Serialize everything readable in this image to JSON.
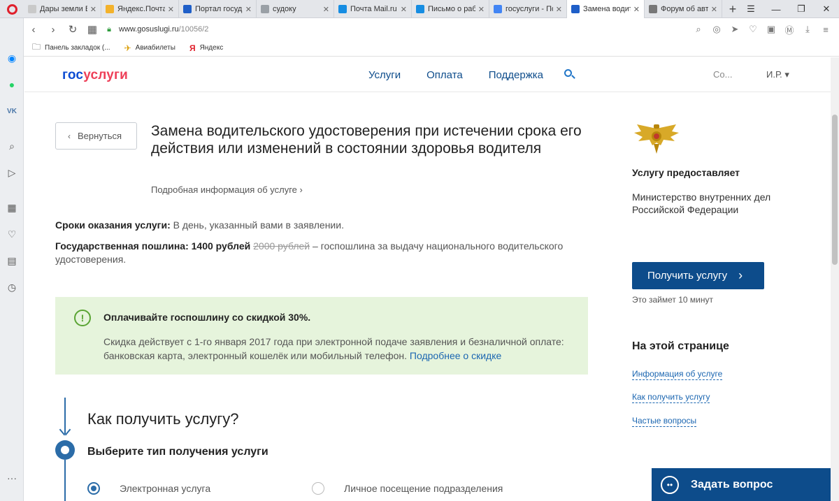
{
  "browser": {
    "tabs": [
      {
        "title": "Дары земли В",
        "fav_color": "#c9c9c9",
        "active": false
      },
      {
        "title": "Яндекс.Почта",
        "fav_color": "#f3b22b",
        "active": false
      },
      {
        "title": "Портал госуд",
        "fav_color": "#1f5fc8",
        "active": false
      },
      {
        "title": "судоку",
        "fav_color": "#9aa0a6",
        "active": false
      },
      {
        "title": "Почта Mail.ru",
        "fav_color": "#168de2",
        "active": false
      },
      {
        "title": "Письмо о раб",
        "fav_color": "#168de2",
        "active": false
      },
      {
        "title": "госуслуги - По",
        "fav_color": "#4285f4",
        "active": false
      },
      {
        "title": "Замена водит",
        "fav_color": "#1f5fc8",
        "active": true
      },
      {
        "title": "Форум об авт",
        "fav_color": "#777777",
        "active": false
      }
    ],
    "url_host": "www.gosuslugi.ru",
    "url_path": "/10056/2",
    "bookmarks": [
      {
        "label": "Панель закладок (...",
        "icon": "folder-icon"
      },
      {
        "label": "Авиабилеты",
        "icon": "plane-icon"
      },
      {
        "label": "Яндекс",
        "icon": "yandex-icon"
      }
    ]
  },
  "header": {
    "logo_part1": "гос",
    "logo_part2": "услуги",
    "nav": [
      "Услуги",
      "Оплата",
      "Поддержка"
    ],
    "user_org": "Со...",
    "user_name": "И.Р. ▾"
  },
  "service": {
    "back_label": "Вернуться",
    "title": "Замена водительского удостоверения при истечении срока его действия или изменений в состоянии здоровья водителя",
    "more_info": "Подробная информация об услуге",
    "terms_label": "Сроки оказания услуги:",
    "terms_value": "В день, указанный вами в заявлении.",
    "fee_label": "Государственная пошлина:",
    "fee_price": "1400 рублей",
    "fee_old": "2000 рублей",
    "fee_desc": "– госпошлина за выдачу национального водительского удостоверения."
  },
  "promo": {
    "title": "Оплачивайте госпошлину со скидкой 30%.",
    "text": "Скидка действует с 1-го января 2017 года при электронной подаче заявления и безналичной оплате: банковская карта, электронный кошелёк или мобильный телефон.",
    "link": "Подробнее о скидке"
  },
  "how": {
    "title": "Как получить услугу?",
    "step_title": "Выберите тип получения услуги",
    "options": [
      {
        "label": "Электронная услуга",
        "selected": true
      },
      {
        "label": "Личное посещение подразделения",
        "selected": false
      }
    ]
  },
  "side": {
    "provider_heading": "Услугу предоставляет",
    "provider": "Министерство внутренних дел Российской Федерации",
    "get_button": "Получить услугу",
    "takes": "Это займет 10 минут",
    "onpage_heading": "На этой странице",
    "onpage_links": [
      "Информация об услуге",
      "Как получить услугу",
      "Частые вопросы"
    ]
  },
  "ask": {
    "label": "Задать вопрос"
  },
  "colors": {
    "accent": "#0d4c8b",
    "link": "#1b66b1",
    "promo_bg": "#e6f4dc",
    "logo_blue": "#0d4cd3",
    "logo_red": "#ee3f58"
  }
}
